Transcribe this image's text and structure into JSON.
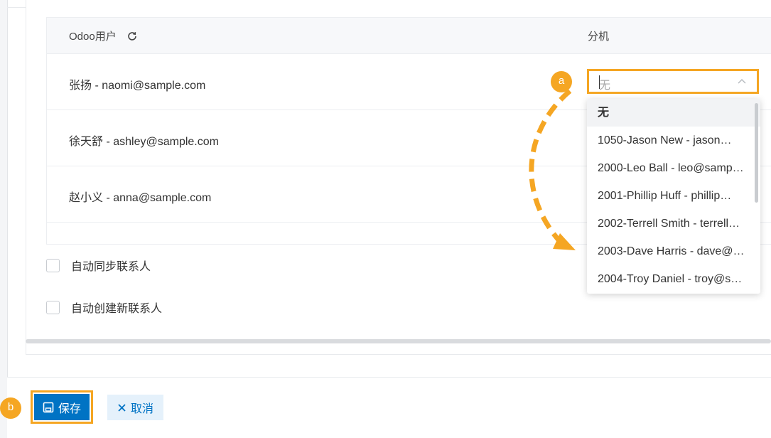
{
  "table": {
    "header": {
      "user_col": "Odoo用户",
      "ext_col": "分机"
    },
    "rows": [
      {
        "label": "张扬 - naomi@sample.com"
      },
      {
        "label": "徐天舒 - ashley@sample.com"
      },
      {
        "label": "赵小义 - anna@sample.com"
      }
    ]
  },
  "extension_select": {
    "value": "无",
    "options": [
      "无",
      "1050-Jason New - jason…",
      "2000-Leo Ball - leo@samp…",
      "2001-Phillip Huff - phillip…",
      "2002-Terrell Smith - terrell…",
      "2003-Dave Harris - dave@…",
      "2004-Troy Daniel - troy@s…"
    ]
  },
  "options": {
    "auto_sync": "自动同步联系人",
    "auto_create": "自动创建新联系人"
  },
  "footer": {
    "save_label": "保存",
    "cancel_label": "取消"
  },
  "annotations": {
    "marker_a": "a",
    "marker_b": "b"
  },
  "colors": {
    "accent": "#f5a623",
    "primary": "#0073c4",
    "secondary_bg": "#e5f1fb"
  },
  "icons": [
    "refresh-icon",
    "chevron-up-icon",
    "save-icon",
    "close-icon"
  ]
}
